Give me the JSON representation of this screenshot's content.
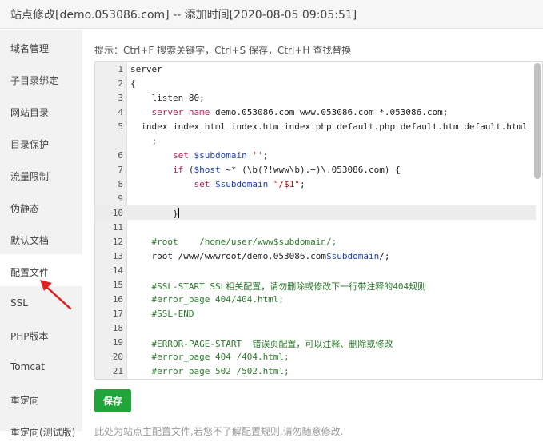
{
  "window": {
    "title": "站点修改[demo.053086.com] -- 添加时间[2020-08-05 09:05:51]"
  },
  "sidebar": {
    "items": [
      {
        "label": "域名管理"
      },
      {
        "label": "子目录绑定"
      },
      {
        "label": "网站目录"
      },
      {
        "label": "目录保护"
      },
      {
        "label": "流量限制"
      },
      {
        "label": "伪静态"
      },
      {
        "label": "默认文档"
      },
      {
        "label": "配置文件",
        "active": true
      },
      {
        "label": "SSL"
      },
      {
        "label": "PHP版本"
      },
      {
        "label": "Tomcat"
      },
      {
        "label": "重定向"
      },
      {
        "label": "重定向(测试版)"
      }
    ]
  },
  "hint": "提示：Ctrl+F 搜索关键字，Ctrl+S 保存，Ctrl+H 查找替换",
  "editor": {
    "lines": [
      {
        "n": "1",
        "text": "server"
      },
      {
        "n": "2",
        "text": "{"
      },
      {
        "n": "3",
        "text": "    listen 80;"
      },
      {
        "n": "4",
        "text": "    server_name demo.053086.com www.053086.com *.053086.com;"
      },
      {
        "n": "5",
        "text": "  index index.html index.htm index.php default.php default.htm default.html"
      },
      {
        "n": "",
        "text": "    ;"
      },
      {
        "n": "6",
        "text": "        set $subdomain '';"
      },
      {
        "n": "7",
        "text": "        if ($host ~* (\\b(?!www\\b).+)\\.053086.com) {"
      },
      {
        "n": "8",
        "text": "            set $subdomain \"/$1\";"
      },
      {
        "n": "9",
        "text": ""
      },
      {
        "n": "10",
        "text": "        }"
      },
      {
        "n": "11",
        "text": ""
      },
      {
        "n": "12",
        "text": "    #root    /home/user/www$subdomain/;"
      },
      {
        "n": "13",
        "text": "    root /www/wwwroot/demo.053086.com$subdomain/;"
      },
      {
        "n": "14",
        "text": ""
      },
      {
        "n": "15",
        "text": "    #SSL-START SSL相关配置，请勿删除或修改下一行带注释的404规则"
      },
      {
        "n": "16",
        "text": "    #error_page 404/404.html;"
      },
      {
        "n": "17",
        "text": "    #SSL-END"
      },
      {
        "n": "18",
        "text": ""
      },
      {
        "n": "19",
        "text": "    #ERROR-PAGE-START  错误页配置，可以注释、删除或修改"
      },
      {
        "n": "20",
        "text": "    #error_page 404 /404.html;"
      },
      {
        "n": "21",
        "text": "    #error_page 502 /502.html;"
      }
    ]
  },
  "save_label": "保存",
  "footnote": "此处为站点主配置文件,若您不了解配置规则,请勿随意修改."
}
